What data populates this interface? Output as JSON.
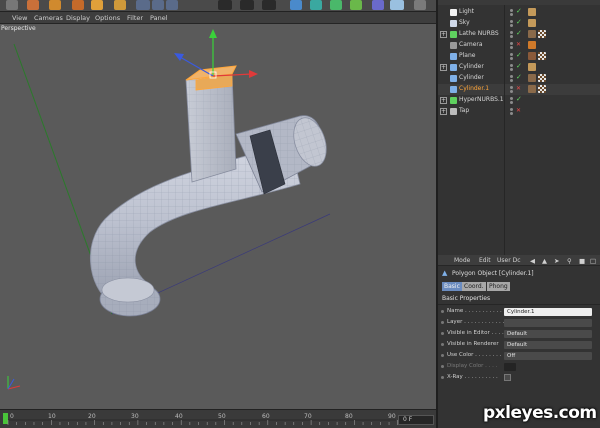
{
  "viewport": {
    "menu": [
      "View",
      "Cameras",
      "Display",
      "Options",
      "Filter",
      "Panel"
    ],
    "label": "Perspective"
  },
  "object_manager": {
    "objects": [
      {
        "name": "Light",
        "icon": "light-icon",
        "expandable": false,
        "selected": false,
        "checked": true
      },
      {
        "name": "Sky",
        "icon": "sky-icon",
        "expandable": false,
        "selected": false,
        "checked": true
      },
      {
        "name": "Lathe NURBS",
        "icon": "lathe-nurbs-icon",
        "expandable": true,
        "selected": false,
        "checked": true
      },
      {
        "name": "Camera",
        "icon": "camera-icon",
        "expandable": false,
        "selected": false,
        "checked": false
      },
      {
        "name": "Plane",
        "icon": "plane-icon",
        "expandable": false,
        "selected": false,
        "checked": true
      },
      {
        "name": "Cylinder",
        "icon": "cylinder-icon",
        "expandable": true,
        "selected": false,
        "checked": true
      },
      {
        "name": "Cylinder",
        "icon": "polygon-object-icon",
        "expandable": false,
        "selected": false,
        "checked": true
      },
      {
        "name": "Cylinder.1",
        "icon": "polygon-object-icon",
        "expandable": false,
        "selected": true,
        "checked": false
      },
      {
        "name": "HyperNURBS.1",
        "icon": "hypernurbs-icon",
        "expandable": true,
        "selected": false,
        "checked": true
      },
      {
        "name": "Tap",
        "icon": "null-object-icon",
        "expandable": true,
        "selected": false,
        "checked": false
      }
    ]
  },
  "attribute_manager": {
    "menu": [
      "Mode",
      "Edit",
      "User Dc"
    ],
    "title": "Polygon Object [Cylinder.1]",
    "tabs": [
      "Basic",
      "Coord.",
      "Phong"
    ],
    "active_tab": "Basic",
    "section": "Basic Properties",
    "fields": [
      {
        "label": "Name . . . . . . . . . . . . .",
        "value": "Cylinder.1",
        "style": "white",
        "dim": false
      },
      {
        "label": "Layer . . . . . . . . . . . . .",
        "value": "",
        "style": "normal",
        "dim": false
      },
      {
        "label": "Visible in Editor . . . .",
        "value": "Default",
        "style": "normal",
        "dim": false
      },
      {
        "label": "Visible in Renderer",
        "value": "Default",
        "style": "normal",
        "dim": false
      },
      {
        "label": "Use Color . . . . . . . .",
        "value": "Off",
        "style": "normal",
        "dim": false
      },
      {
        "label": "Display Color . . . .",
        "value": "",
        "style": "dark",
        "dim": true
      },
      {
        "label": "X-Ray . . . . . . . . . .",
        "value": "",
        "style": "checkbox",
        "dim": false
      }
    ]
  },
  "timeline": {
    "ticks": [
      "0",
      "10",
      "20",
      "30",
      "40",
      "50",
      "60",
      "70",
      "80",
      "90"
    ],
    "current_frame": "0 F"
  },
  "watermark": "pxleyes.com",
  "colors": {
    "viewport_bg": "#5a5a5a",
    "selection": "#ffa63a",
    "axis_x": "#e03a3a",
    "axis_y": "#3ad13a",
    "axis_z": "#3a5ae0",
    "active_tab": "#6b8cc0"
  }
}
